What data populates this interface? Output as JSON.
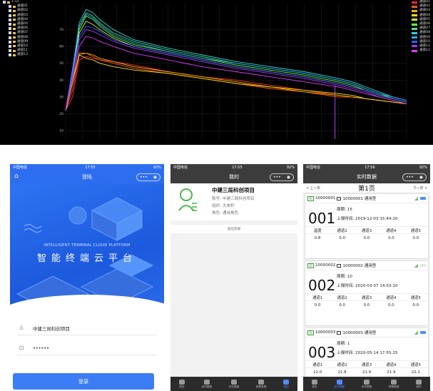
{
  "chart": {
    "tree": {
      "root": "1-12",
      "channels": [
        "通道01",
        "通道02",
        "通道03",
        "通道04",
        "通道05",
        "通道06",
        "通道07",
        "通道08",
        "通道09",
        "通道10",
        "通道11",
        "通道12"
      ]
    },
    "legend": [
      "通道01",
      "通道02",
      "通道03",
      "通道04",
      "通道05",
      "通道06",
      "通道07",
      "通道08",
      "通道09",
      "通道10",
      "通道11",
      "通道12"
    ],
    "y_ticks": [
      "70",
      "60",
      "50",
      "40",
      "30",
      "20",
      "10"
    ]
  },
  "chart_data": {
    "type": "line",
    "ylim": [
      5,
      85
    ],
    "xlim": [
      0,
      100
    ],
    "y_ticks": [
      10,
      20,
      30,
      40,
      50,
      60,
      70
    ],
    "series": [
      {
        "name": "通道01",
        "color": "#ff2a2a",
        "x": [
          0,
          2,
          4,
          6,
          8,
          10,
          14,
          20,
          30,
          40,
          50,
          60,
          70,
          80,
          84,
          88,
          92,
          96,
          100
        ],
        "y": [
          22,
          30,
          52,
          54,
          53,
          52,
          51,
          49,
          45,
          42,
          40,
          37,
          34,
          31,
          30,
          29,
          28,
          27,
          26
        ]
      },
      {
        "name": "通道02",
        "color": "#ff5a1a",
        "x": [
          0,
          2,
          4,
          6,
          8,
          10,
          14,
          20,
          30,
          40,
          50,
          60,
          70,
          80,
          84,
          88,
          92,
          96,
          100
        ],
        "y": [
          22,
          34,
          55,
          56,
          54,
          52,
          50,
          47,
          44,
          41,
          38,
          35,
          33,
          30,
          30,
          29,
          28,
          27,
          26
        ]
      },
      {
        "name": "通道03",
        "color": "#ffb000",
        "x": [
          0,
          2,
          4,
          6,
          8,
          10,
          14,
          20,
          30,
          40,
          50,
          60,
          70,
          80,
          84,
          88,
          92,
          96,
          100
        ],
        "y": [
          22,
          38,
          56,
          56,
          55,
          53,
          51,
          48,
          45,
          42,
          39,
          36,
          33,
          31,
          30,
          29,
          28,
          27,
          26
        ]
      },
      {
        "name": "通道04",
        "color": "#ffe200",
        "x": [
          0,
          2,
          4,
          6,
          8,
          10,
          14,
          20,
          30,
          40,
          50,
          60,
          70,
          80,
          84,
          88,
          92,
          96,
          100
        ],
        "y": [
          22,
          40,
          55,
          53,
          52,
          50,
          48,
          46,
          44,
          41,
          38,
          36,
          34,
          32,
          31,
          29,
          28,
          27,
          26
        ]
      },
      {
        "name": "通道05",
        "color": "#c8ff3a",
        "x": [
          0,
          2,
          4,
          6,
          8,
          10,
          14,
          20,
          30,
          40,
          50,
          60,
          70,
          80,
          84,
          88,
          92,
          96,
          100
        ],
        "y": [
          22,
          44,
          68,
          75,
          73,
          70,
          65,
          60,
          56,
          52,
          48,
          45,
          42,
          38,
          36,
          34,
          31,
          29,
          27
        ]
      },
      {
        "name": "通道06",
        "color": "#6cff3a",
        "x": [
          0,
          2,
          4,
          6,
          8,
          10,
          14,
          20,
          30,
          40,
          50,
          60,
          70,
          80,
          84,
          88,
          92,
          96,
          100
        ],
        "y": [
          22,
          44,
          70,
          78,
          76,
          72,
          66,
          61,
          57,
          53,
          49,
          46,
          43,
          39,
          37,
          34,
          31,
          29,
          27
        ]
      },
      {
        "name": "通道07",
        "color": "#4ae090",
        "x": [
          0,
          2,
          4,
          6,
          8,
          10,
          14,
          20,
          30,
          40,
          50,
          60,
          70,
          80,
          84,
          88,
          92,
          96,
          100
        ],
        "y": [
          22,
          46,
          72,
          80,
          78,
          74,
          68,
          63,
          58,
          54,
          50,
          47,
          44,
          40,
          38,
          35,
          32,
          29,
          27
        ]
      },
      {
        "name": "通道08",
        "color": "#35d4d4",
        "x": [
          0,
          2,
          4,
          6,
          8,
          10,
          14,
          20,
          30,
          40,
          50,
          60,
          70,
          80,
          84,
          88,
          92,
          96,
          100
        ],
        "y": [
          22,
          46,
          74,
          82,
          80,
          76,
          70,
          64,
          59,
          55,
          51,
          48,
          45,
          41,
          39,
          36,
          33,
          30,
          28
        ]
      },
      {
        "name": "通道09",
        "color": "#2aa8ff",
        "x": [
          0,
          2,
          4,
          6,
          8,
          10,
          14,
          20,
          30,
          40,
          50,
          60,
          70,
          80,
          84,
          88,
          92,
          96,
          100
        ],
        "y": [
          22,
          46,
          72,
          79,
          77,
          73,
          67,
          62,
          57,
          53,
          50,
          47,
          44,
          40,
          38,
          35,
          32,
          30,
          28
        ]
      },
      {
        "name": "通道10",
        "color": "#3a5cff",
        "x": [
          0,
          2,
          4,
          6,
          8,
          10,
          14,
          20,
          30,
          40,
          50,
          60,
          70,
          80,
          84,
          88,
          92,
          96,
          100
        ],
        "y": [
          22,
          44,
          66,
          72,
          71,
          69,
          64,
          60,
          56,
          52,
          48,
          45,
          42,
          38,
          36,
          34,
          31,
          29,
          27
        ]
      },
      {
        "name": "通道11",
        "color": "#a13aff",
        "x": [
          0,
          2,
          4,
          6,
          8,
          10,
          14,
          20,
          30,
          40,
          50,
          60,
          70,
          80,
          84,
          88,
          92,
          96,
          100
        ],
        "y": [
          22,
          42,
          64,
          70,
          69,
          67,
          63,
          59,
          55,
          51,
          47,
          44,
          41,
          37,
          35,
          33,
          30,
          28,
          26
        ]
      },
      {
        "name": "通道12",
        "color": "#e03aff",
        "x": [
          0,
          2,
          4,
          6,
          8,
          10,
          14,
          20,
          30,
          40,
          50,
          60,
          70,
          80,
          84,
          88,
          92,
          96,
          100
        ],
        "y": [
          22,
          40,
          60,
          66,
          65,
          63,
          60,
          56,
          52,
          48,
          45,
          42,
          39,
          36,
          34,
          32,
          30,
          28,
          26
        ]
      }
    ]
  },
  "login": {
    "status_carrier": "中国电信",
    "status_time": "17:55",
    "status_battery": "92%",
    "nav_title": "登陆",
    "hero_en": "INTELLIGENT TERMINAL CLOUD PLATFORM",
    "hero_cn": "智能终端云平台",
    "username": "中建三局科创项目",
    "password": "••••••",
    "login_btn": "登录"
  },
  "mine": {
    "status_carrier": "中国电信",
    "status_time": "17:55",
    "status_battery": "92%",
    "nav_title": "我的",
    "project_name": "中建三局科创项目",
    "account": "账号:  中建三局科创项目",
    "org": "组织:  大体积",
    "role": "角色:  通用角色",
    "logout": "退出登录",
    "tabs": [
      "首页",
      "实时数据",
      "历史数据",
      "报警数据",
      "我的"
    ]
  },
  "realtime": {
    "status_carrier": "中国电信",
    "status_time": "17:56",
    "status_battery": "92%",
    "nav_title": "实时数据",
    "prev": "< 上一页",
    "page": "第1页",
    "next": "下一页 >",
    "tabs": [
      "首页",
      "实时数据",
      "历史数据",
      "报警数据",
      "我的"
    ],
    "devices": [
      {
        "id": "10000001",
        "name": "10000001 通用型",
        "num": "001",
        "cycle": "周期: 15",
        "time": "上报时间:  2019-12-03 15:44:20",
        "headers": [
          "温度",
          "通道2",
          "通道3",
          "通道4",
          "通道5"
        ],
        "values": [
          "0.8",
          "0.0",
          "0.0",
          "0.0",
          "0.0"
        ],
        "battery_full": true
      },
      {
        "id": "10000002",
        "name": "10000002 通用型",
        "num": "002",
        "cycle": "周期: 10",
        "time": "上报时间:  2020-03-07 14:53:10",
        "headers": [
          "通道1",
          "通道2",
          "通道3",
          "通道4",
          "通道5"
        ],
        "values": [
          "0.0",
          "0.0",
          "0.0",
          "0.0",
          "0.0"
        ],
        "battery_full": false
      },
      {
        "id": "10000003",
        "name": "10000003 通用型",
        "num": "003",
        "cycle": "周期: 1",
        "time": "上报时间:  2020-05-14 17:55:15",
        "headers": [
          "通道1",
          "通道2",
          "通道3",
          "通道4",
          "通道5"
        ],
        "values": [
          "22.0",
          "21.8",
          "21.9",
          "21.9",
          "22.1"
        ],
        "battery_full": true
      }
    ]
  }
}
